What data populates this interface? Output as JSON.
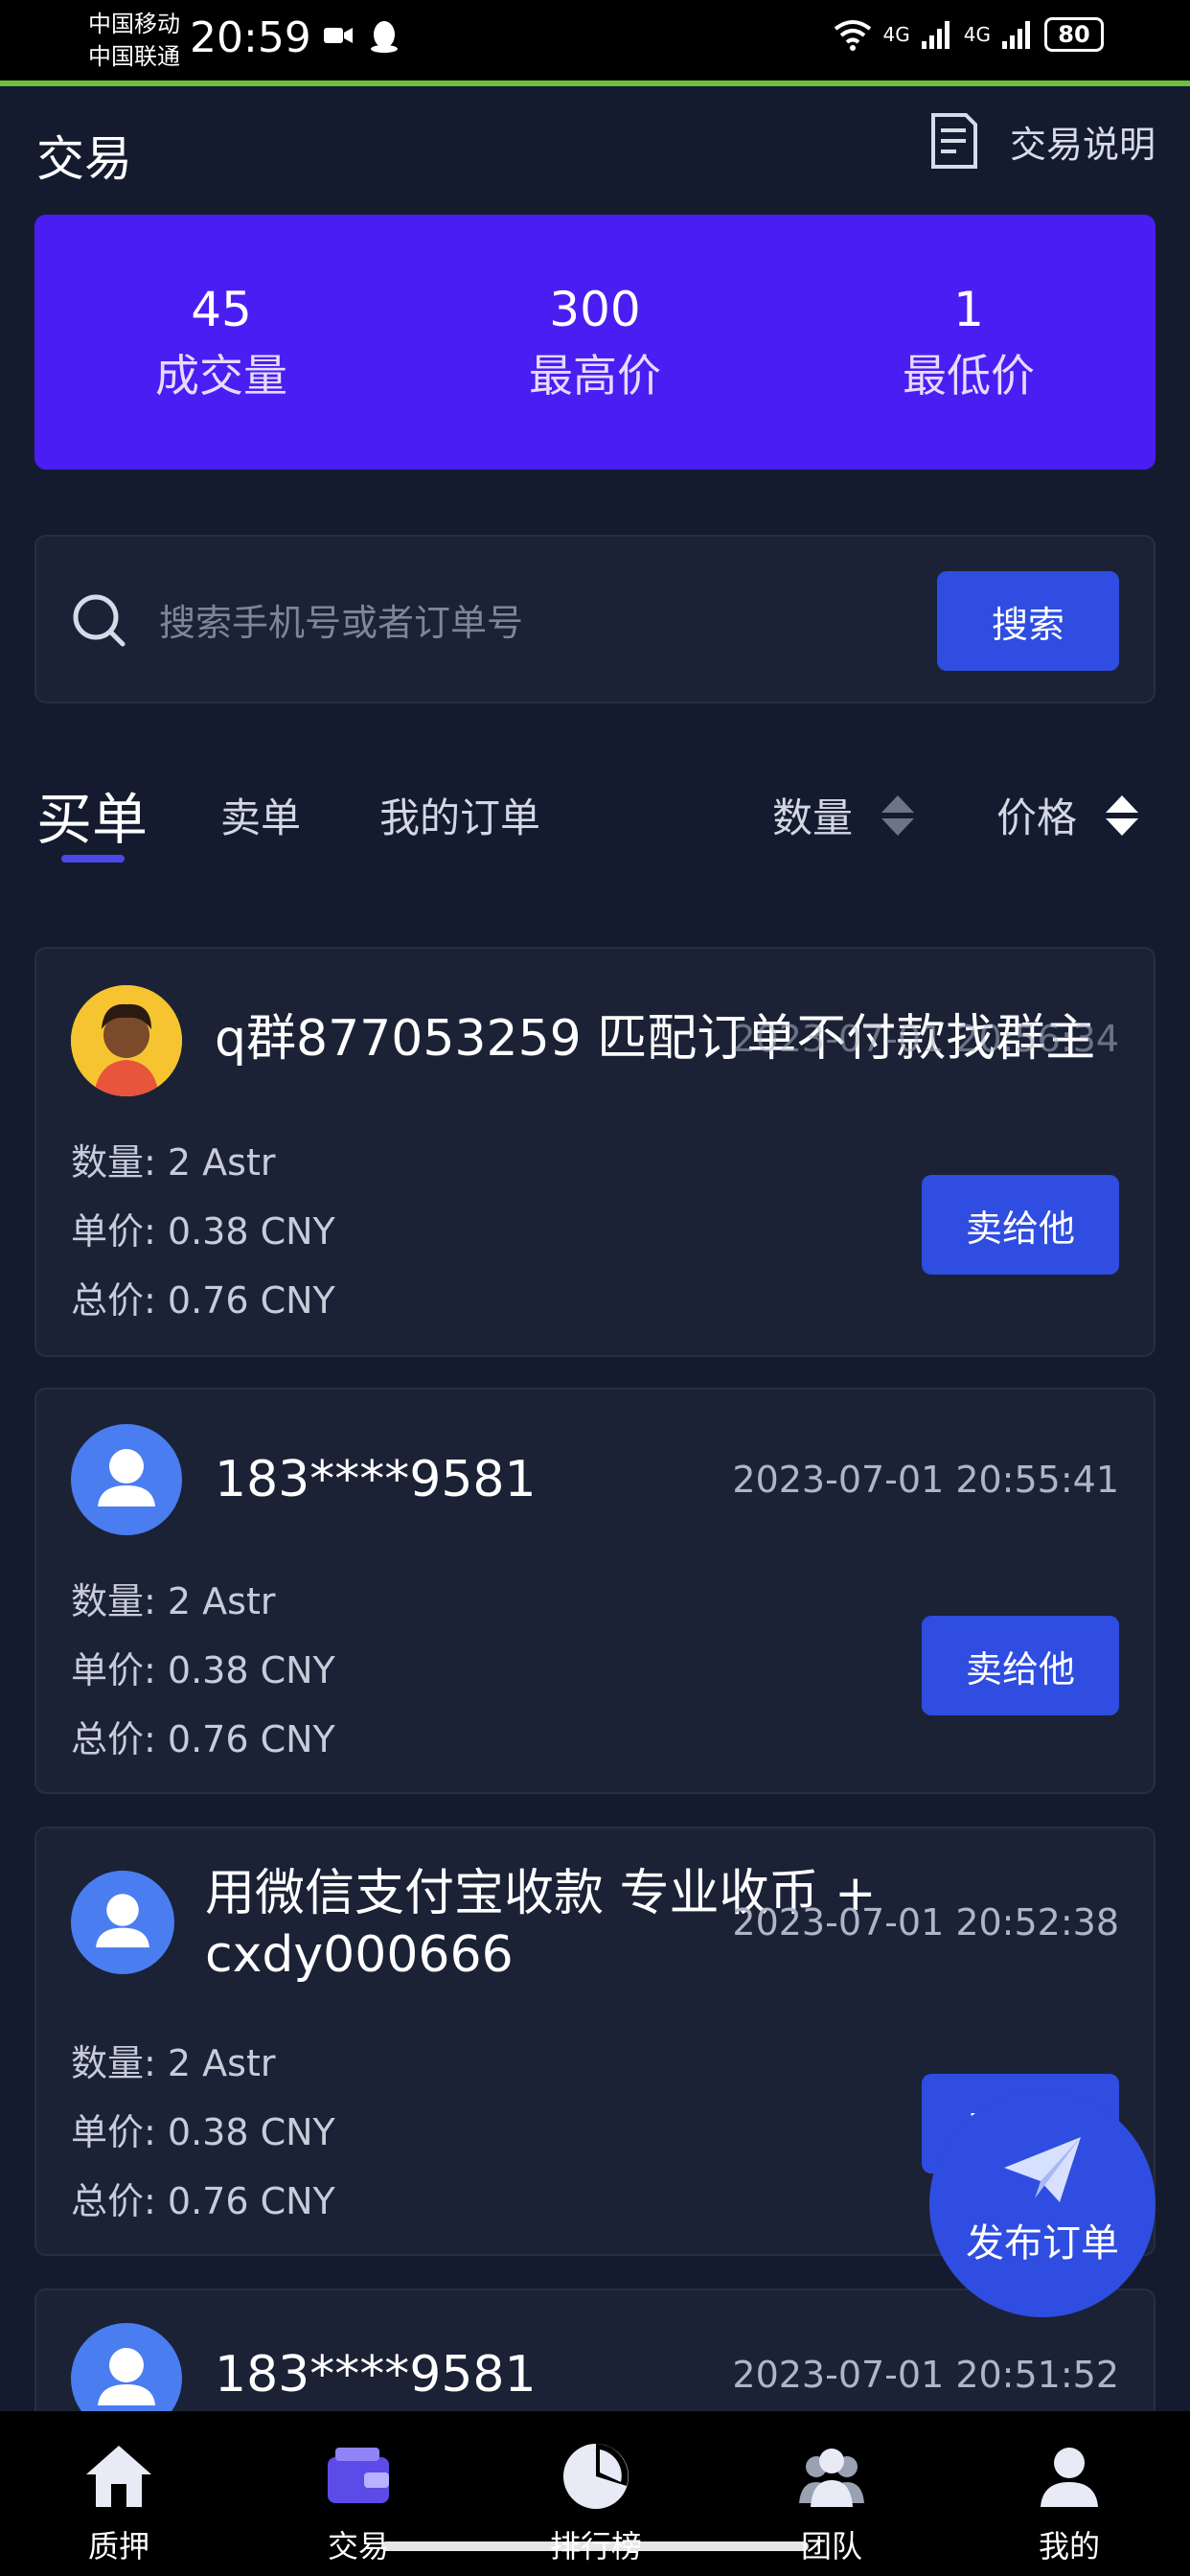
{
  "status_bar": {
    "carrier_1": "中国移动",
    "carrier_2": "中国联通",
    "time": "20:59",
    "network_1": "4G",
    "network_2": "4G",
    "battery": "80"
  },
  "header": {
    "title": "交易",
    "help_label": "交易说明",
    "help_icon": "document-icon"
  },
  "stats": [
    {
      "value": "45",
      "label": "成交量"
    },
    {
      "value": "300",
      "label": "最高价"
    },
    {
      "value": "1",
      "label": "最低价"
    }
  ],
  "search": {
    "placeholder": "搜索手机号或者订单号",
    "button_label": "搜索"
  },
  "tabs": [
    {
      "label": "买单",
      "active": true
    },
    {
      "label": "卖单",
      "active": false
    },
    {
      "label": "我的订单",
      "active": false
    }
  ],
  "sort": [
    {
      "label": "数量"
    },
    {
      "label": "价格"
    }
  ],
  "orders": [
    {
      "name": "q群877053259 匹配订单不付款找群主",
      "time": "2023-07-01 20:56:34",
      "quantity_label": "数量:",
      "quantity": "2 Astr",
      "unit_price_label": "单价:",
      "unit_price": "0.38 CNY",
      "total_label": "总价:",
      "total": "0.76 CNY",
      "button": "卖给他",
      "avatar": "photo"
    },
    {
      "name": "183****9581",
      "time": "2023-07-01 20:55:41",
      "quantity_label": "数量:",
      "quantity": "2 Astr",
      "unit_price_label": "单价:",
      "unit_price": "0.38 CNY",
      "total_label": "总价:",
      "total": "0.76 CNY",
      "button": "卖给他",
      "avatar": "default"
    },
    {
      "name_line1": "用微信支付宝收款 专业收币 +",
      "name_line2": "cxdy000666",
      "time": "2023-07-01 20:52:38",
      "quantity_label": "数量:",
      "quantity": "2 Astr",
      "unit_price_label": "单价:",
      "unit_price": "0.38 CNY",
      "total_label": "总价:",
      "total": "0.76 CNY",
      "button": "卖给他",
      "avatar": "default"
    },
    {
      "name": "183****9581",
      "time": "2023-07-01 20:51:52",
      "avatar": "default"
    }
  ],
  "fab": {
    "label": "发布订单",
    "icon": "paper-plane-icon"
  },
  "bottom_nav": [
    {
      "label": "质押",
      "icon": "home-icon"
    },
    {
      "label": "交易",
      "icon": "wallet-icon"
    },
    {
      "label": "排行榜",
      "icon": "pie-chart-icon"
    },
    {
      "label": "团队",
      "icon": "team-icon"
    },
    {
      "label": "我的",
      "icon": "profile-icon"
    }
  ],
  "colors": {
    "background": "#151b2e",
    "card": "#1b2236",
    "accent": "#2f4de0",
    "stats_card": "#4a1df2"
  }
}
